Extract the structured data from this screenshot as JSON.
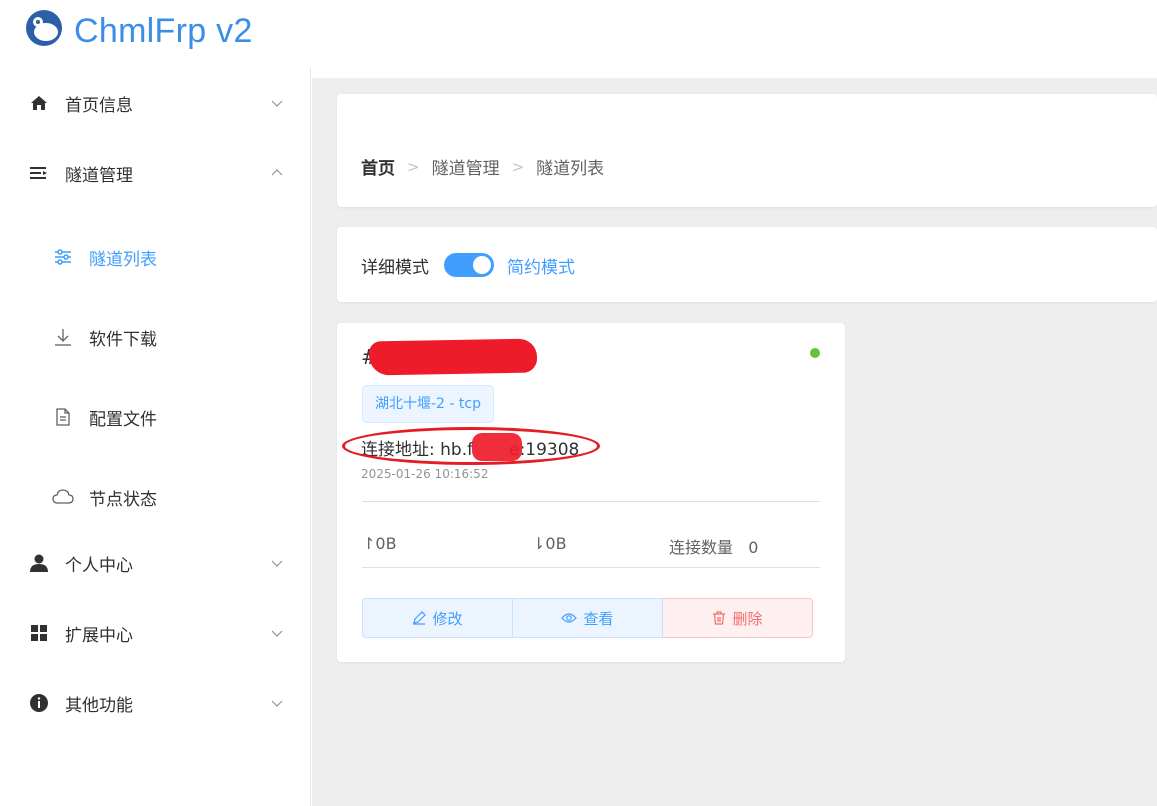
{
  "app": {
    "title": "ChmlFrp v2"
  },
  "sidebar": {
    "items": [
      {
        "label": "首页信息",
        "icon": "home-icon",
        "expanded": false
      },
      {
        "label": "隧道管理",
        "icon": "menu-lines-icon",
        "expanded": true
      },
      {
        "label": "个人中心",
        "icon": "user-icon",
        "expanded": false
      },
      {
        "label": "扩展中心",
        "icon": "grid-icon",
        "expanded": false
      },
      {
        "label": "其他功能",
        "icon": "info-icon",
        "expanded": false
      }
    ],
    "sub_items": [
      {
        "label": "隧道列表",
        "icon": "sliders-icon",
        "active": true
      },
      {
        "label": "软件下载",
        "icon": "download-icon",
        "active": false
      },
      {
        "label": "配置文件",
        "icon": "document-icon",
        "active": false
      },
      {
        "label": "节点状态",
        "icon": "cloud-icon",
        "active": false
      }
    ]
  },
  "breadcrumb": {
    "home": "首页",
    "level1": "隧道管理",
    "level2": "隧道列表"
  },
  "mode": {
    "detail_label": "详细模式",
    "simple_label": "简约模式",
    "simple_on": true
  },
  "tunnel": {
    "name_prefix": "#",
    "status": "online",
    "node_tag": "湖北十堰-2 - tcp",
    "address_label": "连接地址:",
    "address_visible_start": "hb.f",
    "address_visible_end": "e:19308",
    "date": "2025-01-26 10:16:52",
    "upload": "0B",
    "download": "0B",
    "connections_label": "连接数量",
    "connections": "0",
    "btn_edit": "修改",
    "btn_view": "查看",
    "btn_delete": "删除"
  },
  "colors": {
    "accent": "#409eff",
    "online": "#67c23a",
    "danger": "#f56c6c",
    "annotation": "#e51c23"
  }
}
